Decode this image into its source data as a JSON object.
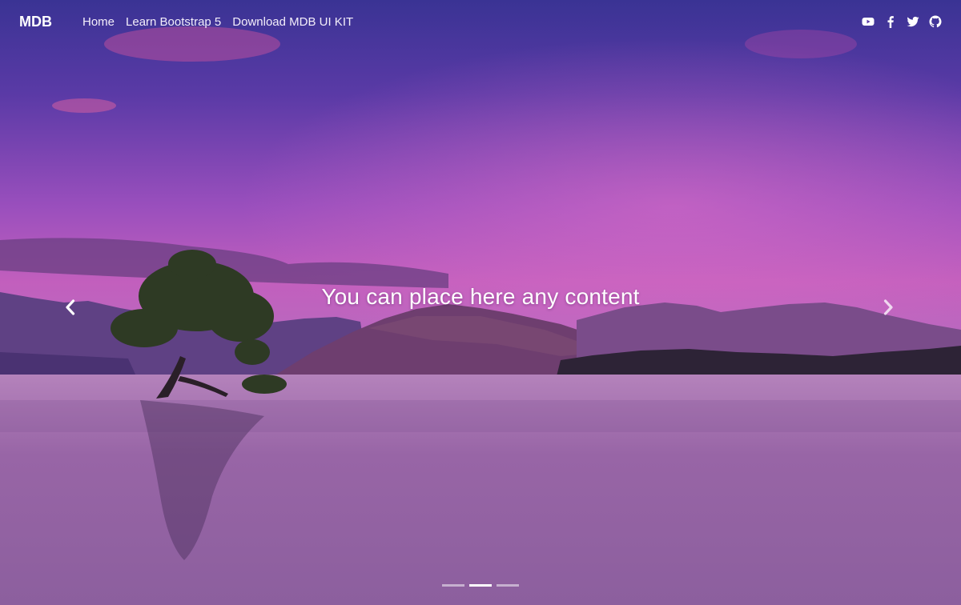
{
  "navbar": {
    "brand": "MDB",
    "links": [
      {
        "label": "Home"
      },
      {
        "label": "Learn Bootstrap 5"
      },
      {
        "label": "Download MDB UI KIT"
      }
    ],
    "social_icons": [
      "youtube-icon",
      "facebook-icon",
      "twitter-icon",
      "github-icon"
    ]
  },
  "carousel": {
    "caption": "You can place here any content",
    "controls": {
      "prev_icon": "chevron-left-icon",
      "next_icon": "chevron-right-icon"
    },
    "slide_count": 3,
    "active_slide": 2
  },
  "colors": {
    "sky_top": "#3f3497",
    "sky_mid": "#8a4cb8",
    "horizon": "#c865b8",
    "water": "#a56aa8",
    "text": "#ffffff"
  }
}
